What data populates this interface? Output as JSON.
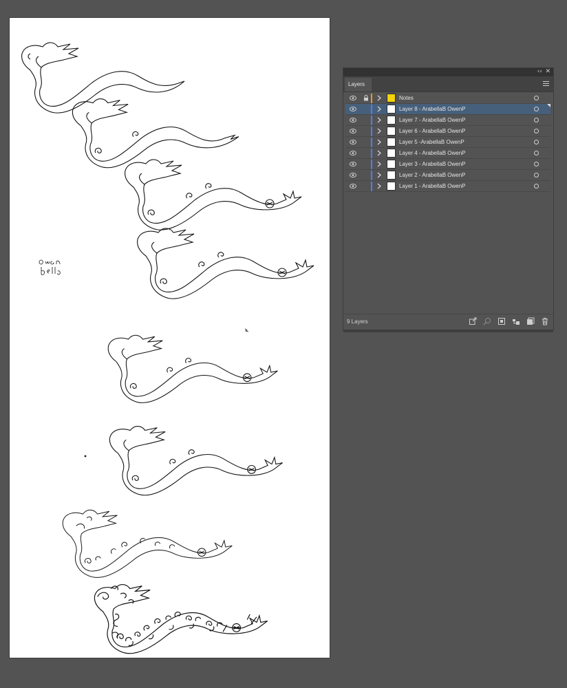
{
  "panel": {
    "title": "Layers",
    "collapse_icon": "double-chevron-left-icon",
    "close_icon": "close-icon",
    "menu_icon": "hamburger-menu-icon",
    "layer_count_text": "9 Layers",
    "layers": [
      {
        "name": "Notes",
        "color": "#f7941d",
        "locked": true,
        "selected": false,
        "notes": true
      },
      {
        "name": "Layer 8 - ArabellaB OwenP",
        "color": "#4f7cff",
        "locked": false,
        "selected": true,
        "notes": false
      },
      {
        "name": "Layer 7 - ArabellaB OwenP",
        "color": "#4f7cff",
        "locked": false,
        "selected": false,
        "notes": false
      },
      {
        "name": "Layer 6 - ArabellaB OwenP",
        "color": "#4f7cff",
        "locked": false,
        "selected": false,
        "notes": false
      },
      {
        "name": "Layer 5 -ArabellaB OwenP",
        "color": "#4f7cff",
        "locked": false,
        "selected": false,
        "notes": false
      },
      {
        "name": "Layer 4 - ArabellaB OwenP",
        "color": "#4f7cff",
        "locked": false,
        "selected": false,
        "notes": false
      },
      {
        "name": "Layer 3 - ArabellaB OwenP",
        "color": "#4f7cff",
        "locked": false,
        "selected": false,
        "notes": false
      },
      {
        "name": "Layer 2 - ArabellaB OwenP",
        "color": "#4f7cff",
        "locked": false,
        "selected": false,
        "notes": false
      },
      {
        "name": "Layer 1 - ArabellaB OwenP",
        "color": "#4f7cff",
        "locked": false,
        "selected": false,
        "notes": false
      }
    ],
    "footer_icons": [
      "export-icon",
      "locate-object-icon",
      "make-clipping-mask-icon",
      "new-sublayer-icon",
      "new-layer-icon",
      "trash-icon"
    ]
  },
  "artboard": {
    "signature_text": "owen bella",
    "drawing_count": 8
  },
  "colors": {
    "canvas_bg": "#535353",
    "panel_bg": "#535353",
    "selected_row": "#46607c",
    "layer_accent": "#4f7cff",
    "notes_accent": "#f7941d"
  }
}
